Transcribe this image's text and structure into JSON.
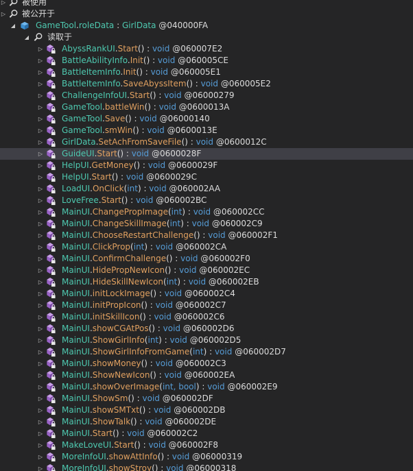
{
  "top_nodes": [
    {
      "label": "被使用"
    },
    {
      "label": "被公开于"
    }
  ],
  "field_node": {
    "type": "GameTool",
    "dot": ".",
    "name": "roleData",
    "sep": " : ",
    "ftype": "GirlData",
    "token": " @040000FA"
  },
  "read_node": {
    "label": "读取于"
  },
  "methods": [
    {
      "type": "AbyssRankUI",
      "name": "Start",
      "params": "",
      "ret": "void",
      "token": "@060007E2"
    },
    {
      "type": "BattleAbilityInfo",
      "name": "Init",
      "params": "",
      "ret": "void",
      "token": "@060005CE"
    },
    {
      "type": "BattleItemInfo",
      "name": "Init",
      "params": "",
      "ret": "void",
      "token": "@060005E1"
    },
    {
      "type": "BattleItemInfo",
      "name": "SaveAbyssItem",
      "params": "",
      "ret": "void",
      "token": "@060005E2"
    },
    {
      "type": "ChallengeInfoUI",
      "name": "Start",
      "params": "",
      "ret": "void",
      "token": "@06000279"
    },
    {
      "type": "GameTool",
      "name": "battleWin",
      "params": "",
      "ret": "void",
      "token": "@0600013A"
    },
    {
      "type": "GameTool",
      "name": "Save",
      "params": "",
      "ret": "void",
      "token": "@06000140"
    },
    {
      "type": "GameTool",
      "name": "smWin",
      "params": "",
      "ret": "void",
      "token": "@0600013E"
    },
    {
      "type": "GirlData",
      "name": "SetAchFromSaveFile",
      "params": "",
      "ret": "void",
      "token": "@0600012C"
    },
    {
      "type": "GuideUI",
      "name": "Start",
      "params": "",
      "ret": "void",
      "token": "@0600028F"
    },
    {
      "type": "HelpUI",
      "name": "GetMoney",
      "params": "",
      "ret": "void",
      "token": "@0600029F"
    },
    {
      "type": "HelpUI",
      "name": "Start",
      "params": "",
      "ret": "void",
      "token": "@0600029C"
    },
    {
      "type": "LoadUI",
      "name": "OnClick",
      "params": "int",
      "ret": "void",
      "token": "@060002AA"
    },
    {
      "type": "LoveFree",
      "name": "Start",
      "params": "",
      "ret": "void",
      "token": "@060002BC"
    },
    {
      "type": "MainUI",
      "name": "ChangePropImage",
      "params": "int",
      "ret": "void",
      "token": "@060002CC"
    },
    {
      "type": "MainUI",
      "name": "ChangeSkillImage",
      "params": "int",
      "ret": "void",
      "token": "@060002C9"
    },
    {
      "type": "MainUI",
      "name": "ChooseRestartChallenge",
      "params": "",
      "ret": "void",
      "token": "@060002F1"
    },
    {
      "type": "MainUI",
      "name": "ClickProp",
      "params": "int",
      "ret": "void",
      "token": "@060002CA"
    },
    {
      "type": "MainUI",
      "name": "ConfirmChallenge",
      "params": "",
      "ret": "void",
      "token": "@060002F0"
    },
    {
      "type": "MainUI",
      "name": "HidePropNewIcon",
      "params": "",
      "ret": "void",
      "token": "@060002EC"
    },
    {
      "type": "MainUI",
      "name": "HideSkillNewIcon",
      "params": "int",
      "ret": "void",
      "token": "@060002EB"
    },
    {
      "type": "MainUI",
      "name": "initLockImage",
      "params": "",
      "ret": "void",
      "token": "@060002C4"
    },
    {
      "type": "MainUI",
      "name": "initPropIcon",
      "params": "",
      "ret": "void",
      "token": "@060002C7"
    },
    {
      "type": "MainUI",
      "name": "initSkillIcon",
      "params": "",
      "ret": "void",
      "token": "@060002C6"
    },
    {
      "type": "MainUI",
      "name": "showCGAtPos",
      "params": "",
      "ret": "void",
      "token": "@060002D6"
    },
    {
      "type": "MainUI",
      "name": "ShowGirlInfo",
      "params": "int",
      "ret": "void",
      "token": "@060002D5"
    },
    {
      "type": "MainUI",
      "name": "ShowGirlInfoFromGame",
      "params": "int",
      "ret": "void",
      "token": "@060002D7"
    },
    {
      "type": "MainUI",
      "name": "showMoney",
      "params": "",
      "ret": "void",
      "token": "@060002C3"
    },
    {
      "type": "MainUI",
      "name": "ShowNewIcon",
      "params": "",
      "ret": "void",
      "token": "@060002EA"
    },
    {
      "type": "MainUI",
      "name": "showOverImage",
      "params": "int, bool",
      "ret": "void",
      "token": "@060002E9"
    },
    {
      "type": "MainUI",
      "name": "ShowSm",
      "params": "",
      "ret": "void",
      "token": "@060002DF"
    },
    {
      "type": "MainUI",
      "name": "showSMTxt",
      "params": "",
      "ret": "void",
      "token": "@060002DB"
    },
    {
      "type": "MainUI",
      "name": "ShowTalk",
      "params": "",
      "ret": "void",
      "token": "@060002DE"
    },
    {
      "type": "MainUI",
      "name": "Start",
      "params": "",
      "ret": "void",
      "token": "@060002C2"
    },
    {
      "type": "MakeLoveUI",
      "name": "Start",
      "params": "",
      "ret": "void",
      "token": "@060002F8"
    },
    {
      "type": "MoreInfoUI",
      "name": "showAttInfo",
      "params": "",
      "ret": "void",
      "token": "@06000319"
    },
    {
      "type": "MoreInfoUI",
      "name": "showStroy",
      "params": "",
      "ret": "void",
      "token": "@06000318"
    }
  ],
  "selected_index": 9,
  "colors": {
    "background": "#252526",
    "selection": "#3f3f46",
    "type_name": "#4ec9b0",
    "method_name": "#e0a060",
    "keyword": "#569cd6",
    "token": "#b5cea8",
    "method_icon": "#b180d7"
  },
  "icons": {
    "search": "search-icon",
    "field": "field-icon",
    "method": "method-icon",
    "method_lock": "lock-badge-icon",
    "expand": "chevron-right-icon",
    "expanded": "chevron-down-icon"
  }
}
